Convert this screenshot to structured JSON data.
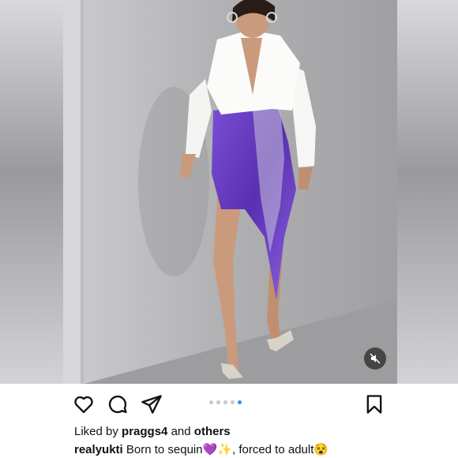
{
  "post": {
    "image_alt": "Woman in white shirt and purple sequin skirt posing against a wall",
    "carousel": {
      "count": 5,
      "active_index": 4
    }
  },
  "likes": {
    "prefix": "Liked by ",
    "user": "praggs4",
    "middle": " and ",
    "others": "others"
  },
  "caption": {
    "username": "realyukti",
    "text": " Born to sequin",
    "emoji_heart": "💜",
    "emoji_sparkles": "✨",
    "text2": ", forced to adult",
    "emoji_face": "😵"
  },
  "icons": [
    "heart-icon",
    "comment-icon",
    "share-icon",
    "bookmark-icon",
    "mute-icon"
  ],
  "colors": {
    "accent_dot": "#2f8fe8",
    "skirt": "#6a3fc4"
  }
}
